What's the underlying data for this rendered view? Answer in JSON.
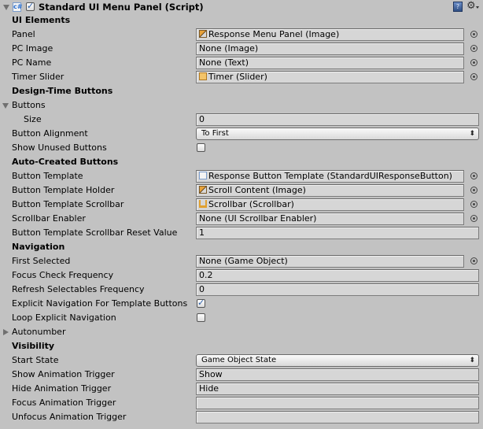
{
  "header": {
    "title": "Standard UI Menu Panel (Script)",
    "enabled": true,
    "icons": [
      "foldout-open-icon",
      "csharp-script-icon",
      "help-icon",
      "gear-icon"
    ]
  },
  "sections": {
    "ui_elements": "UI Elements",
    "design_time": "Design-Time Buttons",
    "auto_created": "Auto-Created Buttons",
    "navigation": "Navigation",
    "visibility": "Visibility"
  },
  "fields": {
    "panel": {
      "label": "Panel",
      "value": "Response Menu Panel (Image)"
    },
    "pc_image": {
      "label": "PC Image",
      "value": "None (Image)"
    },
    "pc_name": {
      "label": "PC Name",
      "value": "None (Text)"
    },
    "timer_slider": {
      "label": "Timer Slider",
      "value": "Timer (Slider)"
    },
    "buttons": {
      "label": "Buttons"
    },
    "size": {
      "label": "Size",
      "value": "0"
    },
    "button_alignment": {
      "label": "Button Alignment",
      "value": "To First"
    },
    "show_unused_buttons": {
      "label": "Show Unused Buttons",
      "checked": false
    },
    "button_template": {
      "label": "Button Template",
      "value": "Response Button Template (StandardUIResponseButton)"
    },
    "button_template_holder": {
      "label": "Button Template Holder",
      "value": "Scroll Content (Image)"
    },
    "button_template_scrollbar": {
      "label": "Button Template Scrollbar",
      "value": "Scrollbar (Scrollbar)"
    },
    "scrollbar_enabler": {
      "label": "Scrollbar Enabler",
      "value": "None (UI Scrollbar Enabler)"
    },
    "scrollbar_reset_value": {
      "label": "Button Template Scrollbar Reset Value",
      "value": "1"
    },
    "first_selected": {
      "label": "First Selected",
      "value": "None (Game Object)"
    },
    "focus_check_frequency": {
      "label": "Focus Check Frequency",
      "value": "0.2"
    },
    "refresh_selectables_frequency": {
      "label": "Refresh Selectables Frequency",
      "value": "0"
    },
    "explicit_navigation": {
      "label": "Explicit Navigation For Template Buttons",
      "checked": true
    },
    "loop_explicit_navigation": {
      "label": "Loop Explicit Navigation",
      "checked": false
    },
    "autonumber": {
      "label": "Autonumber"
    },
    "start_state": {
      "label": "Start State",
      "value": "Game Object State"
    },
    "show_animation_trigger": {
      "label": "Show Animation Trigger",
      "value": "Show"
    },
    "hide_animation_trigger": {
      "label": "Hide Animation Trigger",
      "value": "Hide"
    },
    "focus_animation_trigger": {
      "label": "Focus Animation Trigger",
      "value": ""
    },
    "unfocus_animation_trigger": {
      "label": "Unfocus Animation Trigger",
      "value": ""
    }
  },
  "glyphs": {
    "help": "?",
    "gear": "⚙",
    "csharp": "c#",
    "dropdown_arrows": "⬍"
  }
}
